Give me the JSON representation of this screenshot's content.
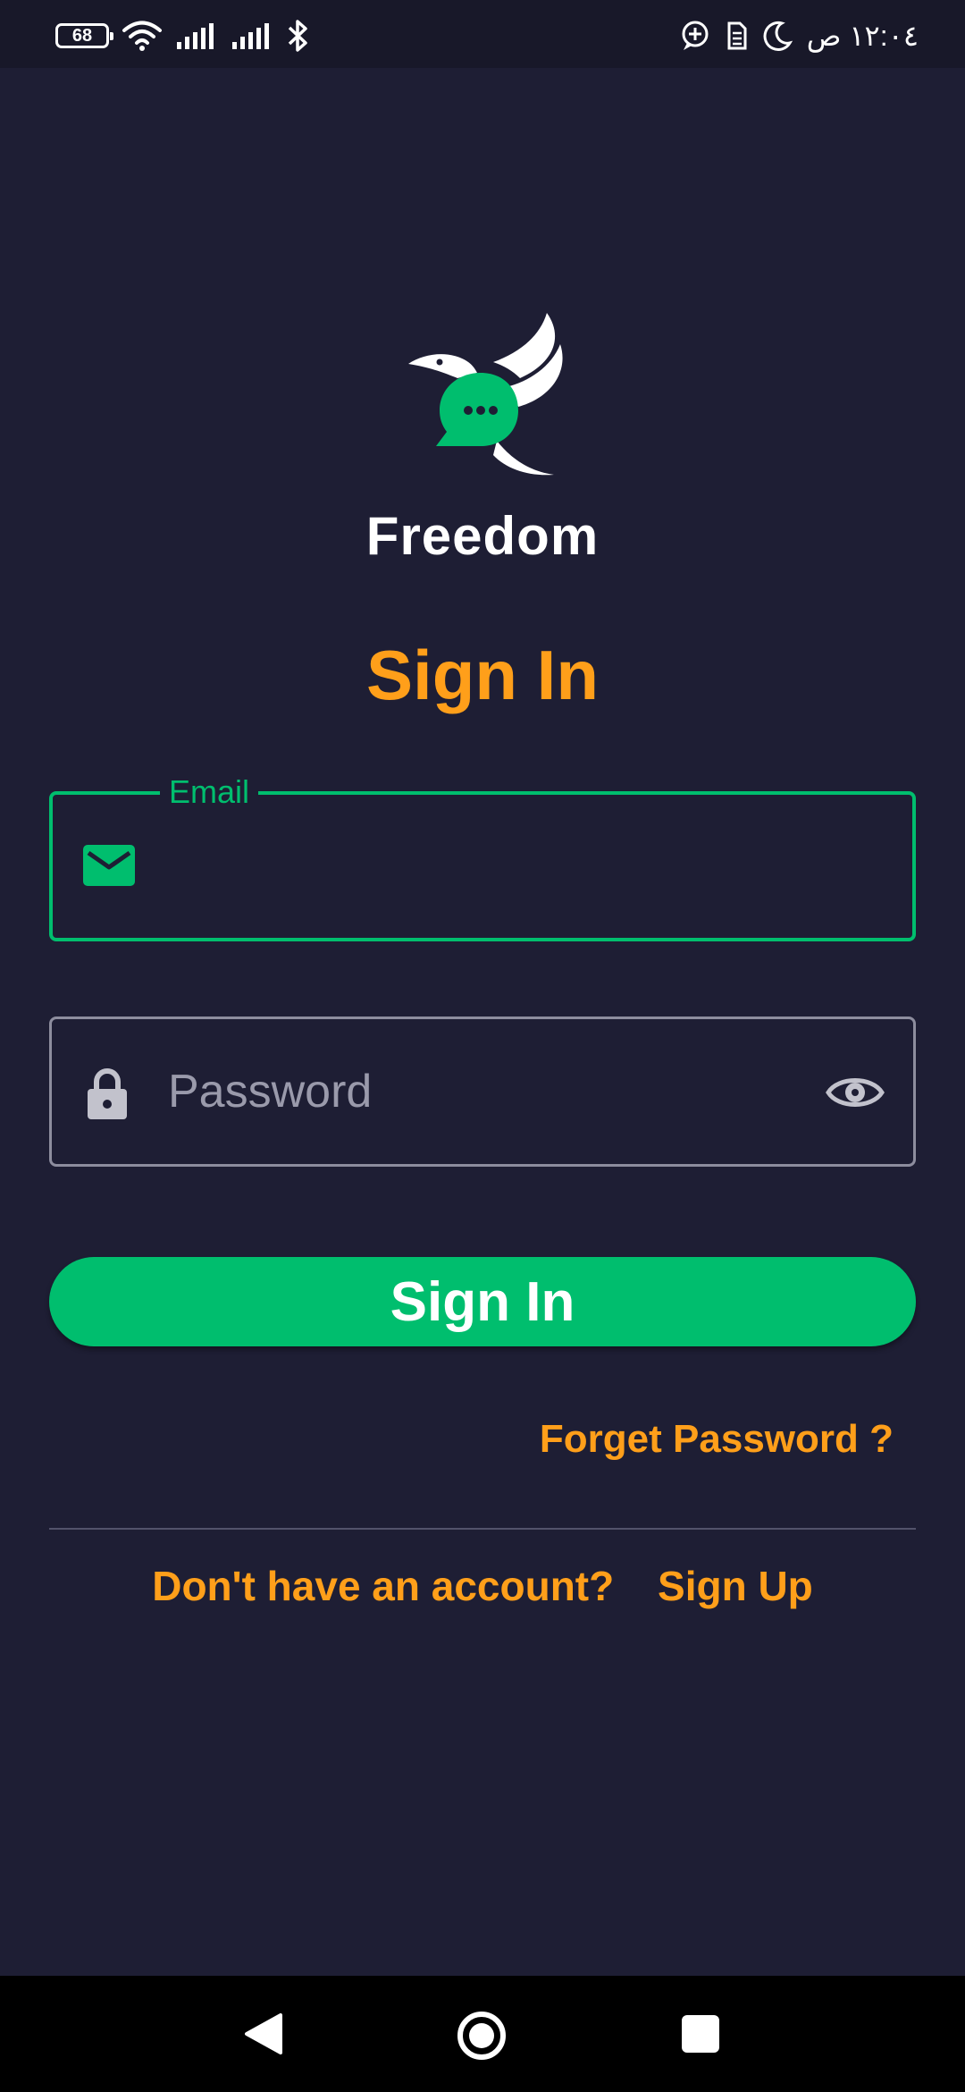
{
  "status_bar": {
    "battery_level": "68",
    "time": "١٢:٠٤ ص",
    "icons": [
      "battery-icon",
      "wifi-icon",
      "signal-icon",
      "signal-icon",
      "bluetooth-icon",
      "app-notification-icon",
      "sim-icon",
      "do-not-disturb-moon-icon"
    ]
  },
  "app": {
    "name": "Freedom",
    "logo": "bird-chat-logo"
  },
  "page": {
    "title": "Sign In"
  },
  "form": {
    "email": {
      "label": "Email",
      "value": "",
      "icon": "mail-icon"
    },
    "password": {
      "placeholder": "Password",
      "value": "",
      "icon": "lock-icon",
      "toggle_icon": "eye-icon"
    },
    "submit_label": "Sign In",
    "forgot_label": "Forget Password ?"
  },
  "footer": {
    "prompt": "Don't have an account?",
    "signup_label": "Sign Up"
  },
  "colors": {
    "background": "#1e1e34",
    "accent_green": "#00be6e",
    "accent_orange": "#ff9f1a"
  },
  "nav_bar": {
    "icons": [
      "back-icon",
      "home-icon",
      "recents-icon"
    ]
  }
}
